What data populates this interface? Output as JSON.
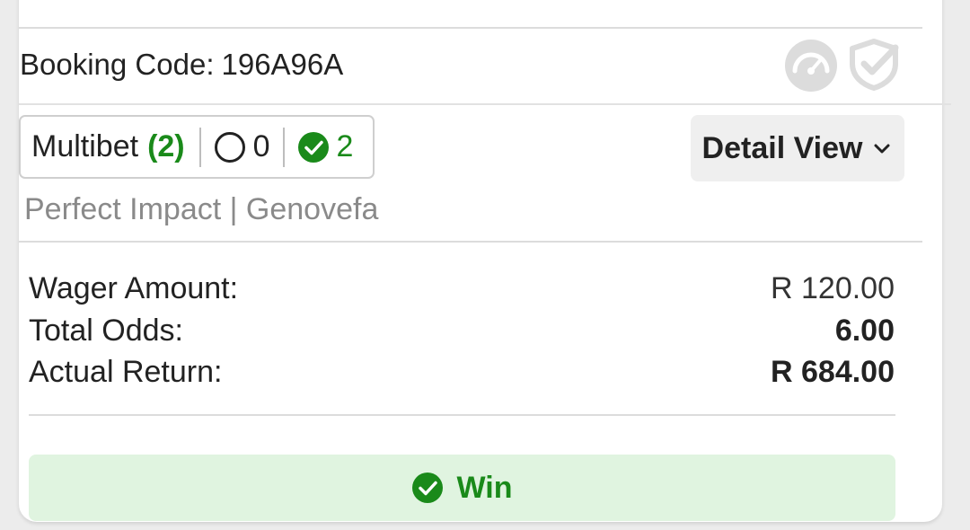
{
  "booking": {
    "label": "Booking Code:",
    "code": "196A96A",
    "icons": [
      "speedometer-icon",
      "shield-check-icon"
    ]
  },
  "bet_summary": {
    "type_label": "Multibet",
    "count": "(2)",
    "open_count": "0",
    "won_count": "2"
  },
  "detail_view": {
    "label": "Detail View"
  },
  "selections_text": "Perfect Impact | Genovefa",
  "details": {
    "wager_label": "Wager Amount:",
    "wager_value": "R 120.00",
    "odds_label": "Total Odds:",
    "odds_value": "6.00",
    "return_label": "Actual Return:",
    "return_value": "R 684.00"
  },
  "result": {
    "label": "Win",
    "color": "#1a8a1a",
    "background": "#e0f4e0"
  },
  "colors": {
    "success": "#1a8a1a",
    "icon_grey": "#dcdcdc"
  }
}
